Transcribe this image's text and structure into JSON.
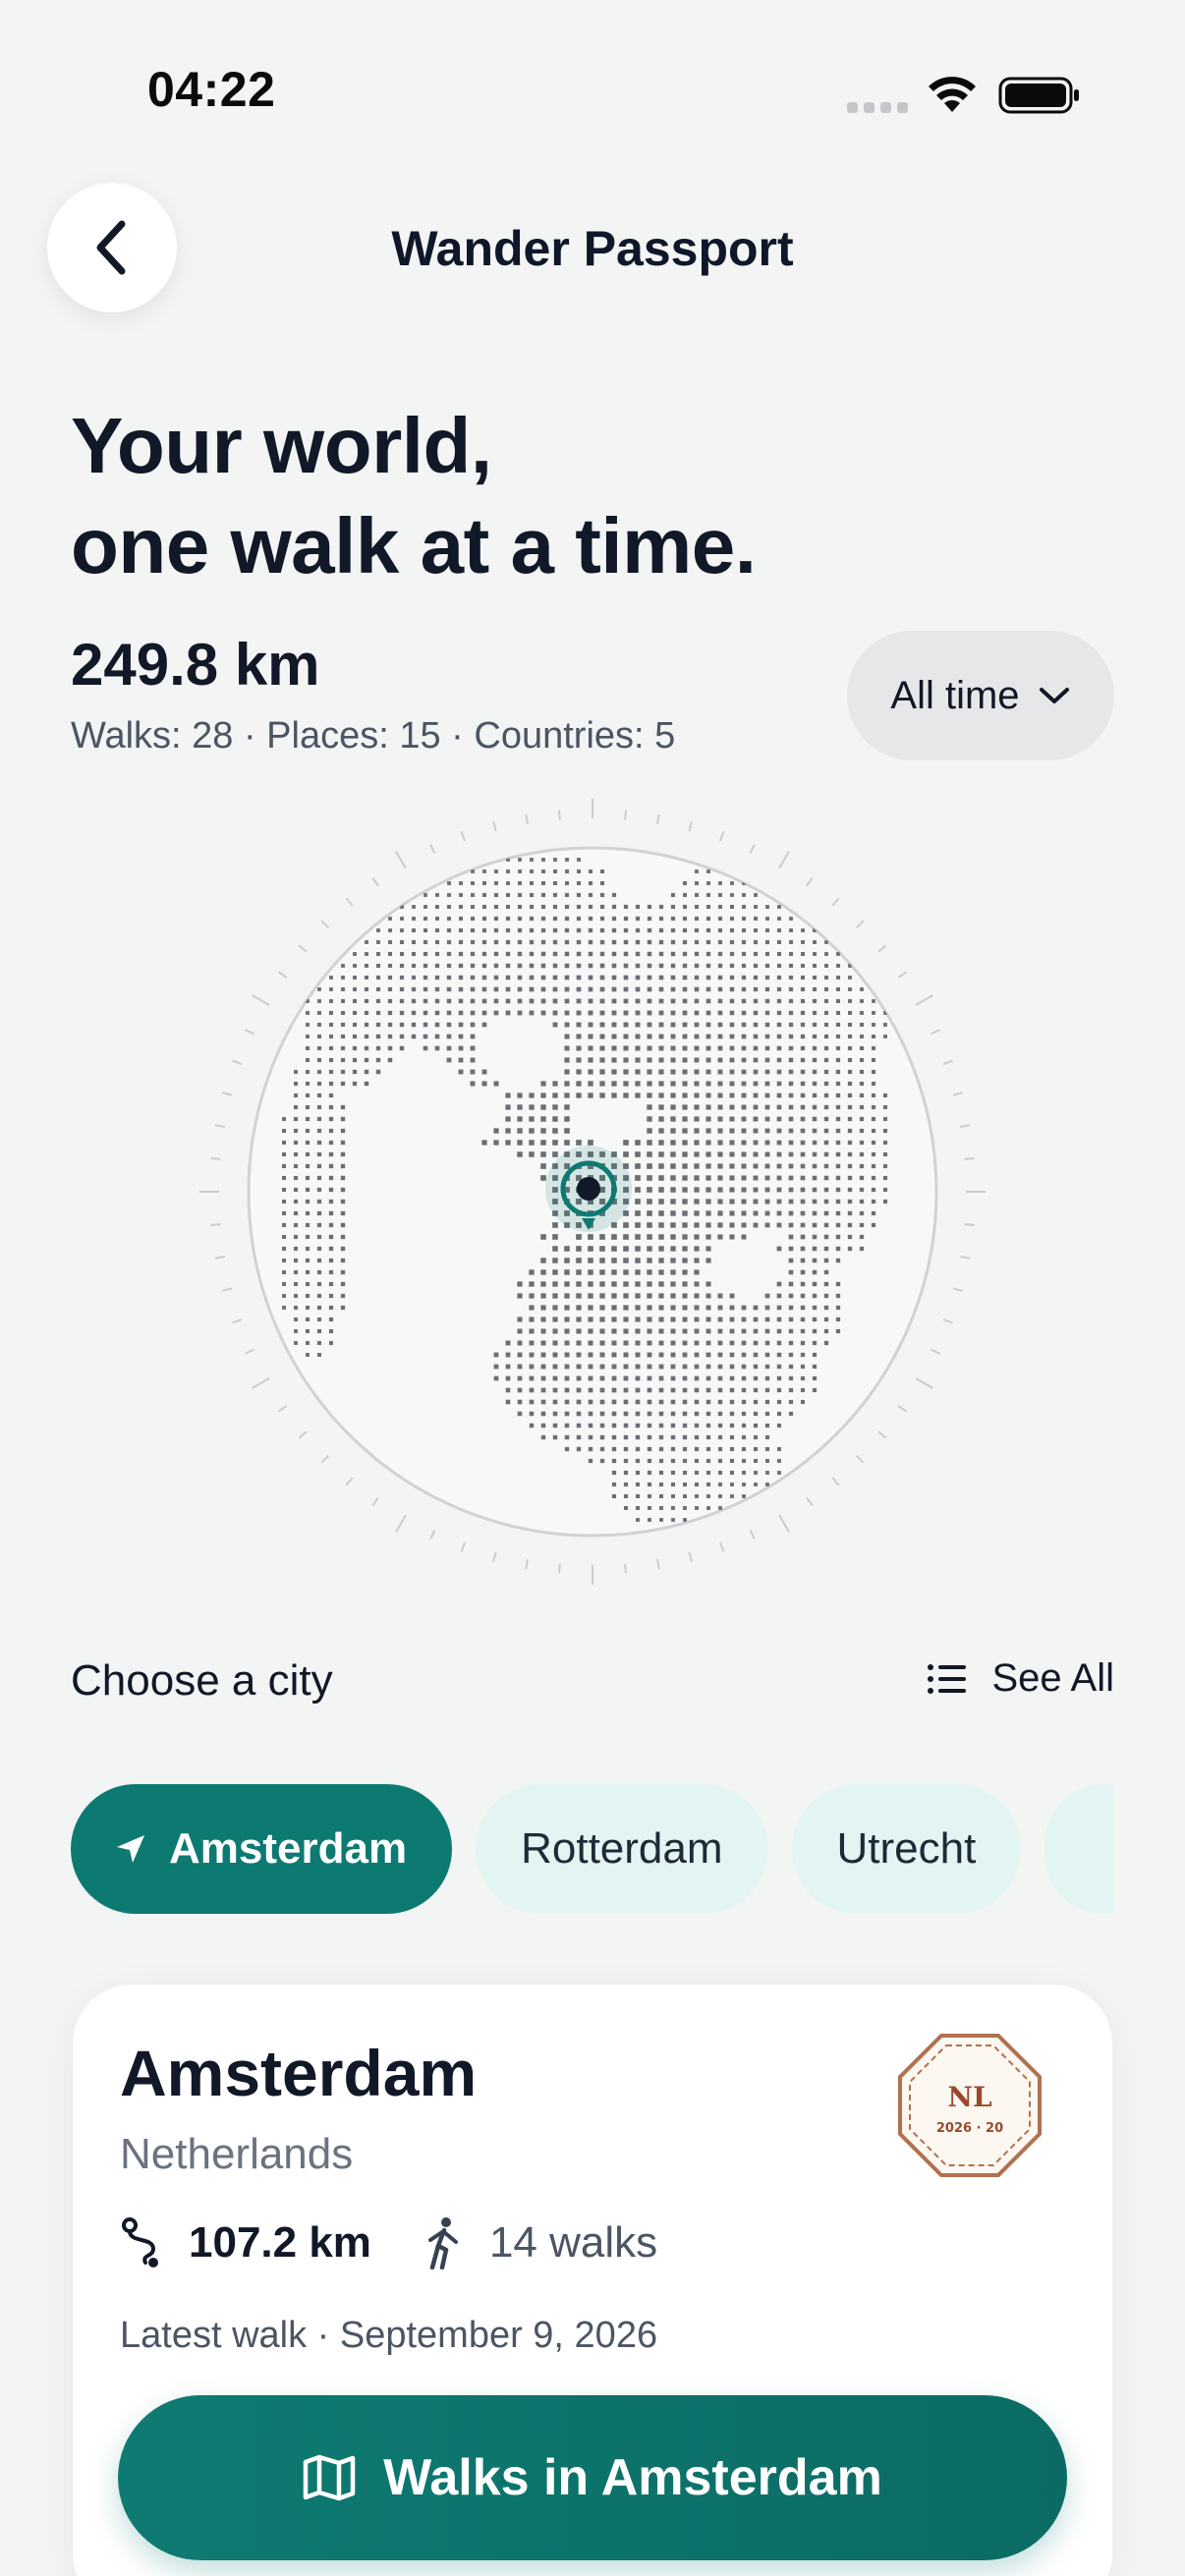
{
  "status_bar": {
    "time": "04:22",
    "icons": [
      "cellular-dots-icon",
      "wifi-icon",
      "battery-icon"
    ]
  },
  "header": {
    "title": "Wander Passport",
    "back_icon": "chevron-left-icon"
  },
  "hero": {
    "line1": "Your world,",
    "line2": "one walk at a time."
  },
  "summary": {
    "total_distance": "249.8 km",
    "stats_line": "Walks: 28 · Places: 15 · Countries: 5",
    "period": "All time",
    "period_icon": "chevron-down-icon"
  },
  "globe": {
    "description_icon": "globe-map-icon",
    "pin_icon": "location-pin-icon"
  },
  "cities": {
    "heading": "Choose a city",
    "see_all": "See All",
    "see_all_icon": "list-icon",
    "chips": [
      {
        "label": "Amsterdam",
        "active": true,
        "icon": "navigation-arrow-icon"
      },
      {
        "label": "Rotterdam",
        "active": false
      },
      {
        "label": "Utrecht",
        "active": false
      },
      {
        "label": "",
        "active": false
      }
    ]
  },
  "city_card": {
    "city": "Amsterdam",
    "country": "Netherlands",
    "stamp_text": "NL",
    "stamp_sub": "2026 · 20",
    "distance": "107.2 km",
    "walks": "14 walks",
    "latest_walk": "Latest walk · September 9, 2026",
    "button_label": "Walks in Amsterdam",
    "button_icon": "map-icon"
  },
  "colors": {
    "accent": "#0d7a72",
    "chip_inactive": "#e2f5f2",
    "background": "#f3f4f4"
  }
}
